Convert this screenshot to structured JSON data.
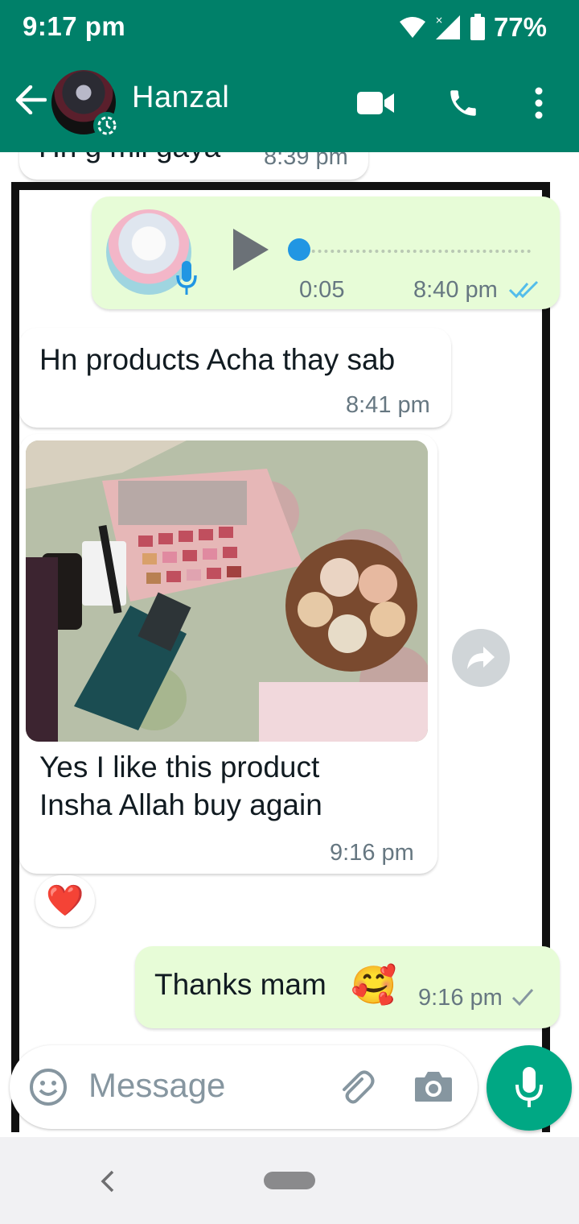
{
  "status_bar": {
    "time": "9:17 pm",
    "battery": "77%"
  },
  "header": {
    "contact_name": "Hanzal"
  },
  "messages": {
    "m0": {
      "text": "Hn g mil gaya",
      "time": "8:39 pm"
    },
    "voice": {
      "duration": "0:05",
      "time": "8:40 pm"
    },
    "m1": {
      "text": "Hn products Acha thay sab",
      "time": "8:41 pm"
    },
    "m2": {
      "caption_line1": "Yes I like this product",
      "caption_line2": "Insha Allah buy again",
      "time": "9:16 pm",
      "reaction": "❤️"
    },
    "m3": {
      "text": "Thanks mam",
      "emoji": "🥰",
      "time": "9:16 pm"
    }
  },
  "input": {
    "placeholder": "Message"
  },
  "colors": {
    "header": "#008069",
    "outgoing_bubble": "#e7fcd7",
    "accent_blue": "#53bdeb",
    "fab": "#00a884"
  }
}
